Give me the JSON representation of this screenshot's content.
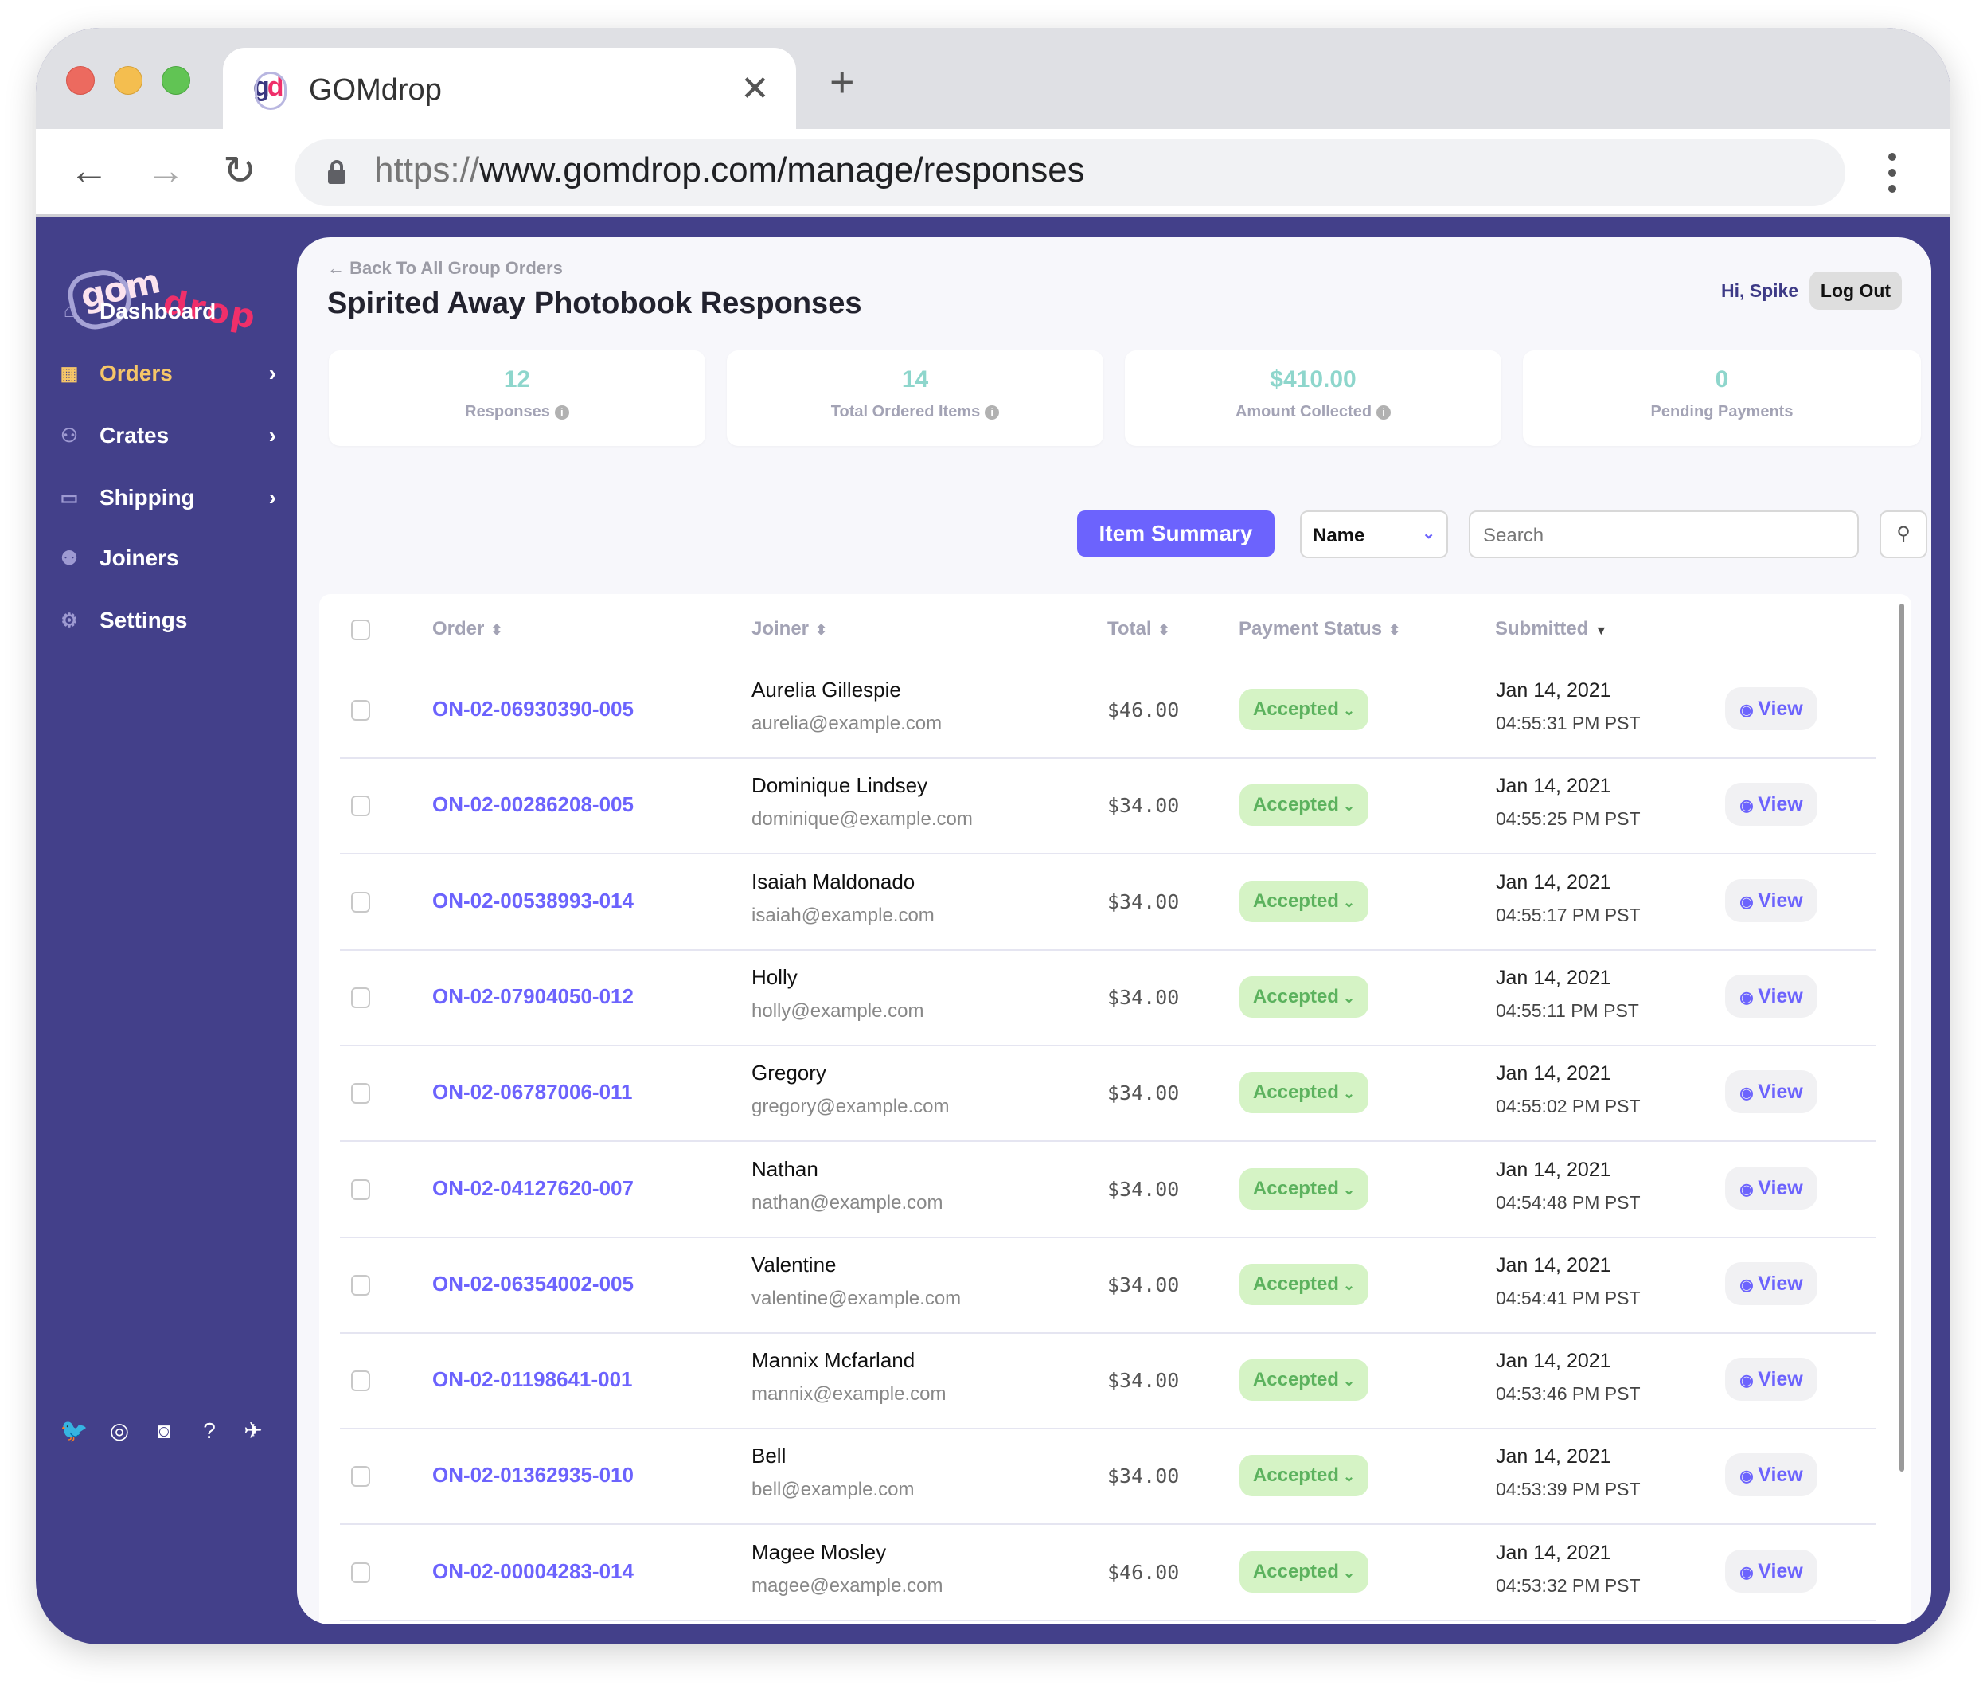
{
  "browser": {
    "tab_title": "GOMdrop",
    "tab_favicon": "gd",
    "url_protocol": "https://",
    "url_rest": "www.gomdrop.com/manage/responses",
    "close_tab": "✕",
    "new_tab": "+"
  },
  "sidebar": {
    "logo_part1": "gom",
    "logo_part2": "drop",
    "items": [
      {
        "label": "Dashboard",
        "icon": "home-icon",
        "glyph": "⌂",
        "has_chevron": false,
        "active": false
      },
      {
        "label": "Orders",
        "icon": "grid-icon",
        "glyph": "▦",
        "has_chevron": true,
        "active": true
      },
      {
        "label": "Crates",
        "icon": "people-carry-icon",
        "glyph": "⚇",
        "has_chevron": true,
        "active": false
      },
      {
        "label": "Shipping",
        "icon": "box-open-icon",
        "glyph": "▭",
        "has_chevron": true,
        "active": false
      },
      {
        "label": "Joiners",
        "icon": "users-icon",
        "glyph": "⚉",
        "has_chevron": false,
        "active": false
      },
      {
        "label": "Settings",
        "icon": "gear-icon",
        "glyph": "⚙",
        "has_chevron": false,
        "active": false
      }
    ],
    "chevron": "›",
    "social": [
      {
        "name": "twitter-icon",
        "glyph": "🐦"
      },
      {
        "name": "instagram-icon",
        "glyph": "◎"
      },
      {
        "name": "discord-icon",
        "glyph": "◙"
      },
      {
        "name": "help-icon",
        "glyph": "?"
      },
      {
        "name": "airplane-icon",
        "glyph": "✈"
      }
    ]
  },
  "header": {
    "back_link": "← Back To All Group Orders",
    "title": "Spirited Away Photobook Responses",
    "greeting": "Hi, Spike",
    "logout_label": "Log Out"
  },
  "stats": [
    {
      "value": "12",
      "label": "Responses",
      "info": true
    },
    {
      "value": "14",
      "label": "Total Ordered Items",
      "info": true
    },
    {
      "value": "$410.00",
      "label": "Amount Collected",
      "info": true
    },
    {
      "value": "0",
      "label": "Pending Payments",
      "info": false
    }
  ],
  "toolbar": {
    "item_summary_label": "Item Summary",
    "filter_selected": "Name",
    "search_placeholder": "Search"
  },
  "table": {
    "columns": [
      {
        "label": "Order",
        "sort": "both"
      },
      {
        "label": "Joiner",
        "sort": "both"
      },
      {
        "label": "Total",
        "sort": "both"
      },
      {
        "label": "Payment Status",
        "sort": "both"
      },
      {
        "label": "Submitted",
        "sort": "desc"
      }
    ],
    "view_label": "View",
    "rows": [
      {
        "order": "ON-02-06930390-005",
        "name": "Aurelia Gillespie",
        "email": "aurelia@example.com",
        "total": "$46.00",
        "status": "Accepted",
        "date": "Jan 14, 2021",
        "time": "04:55:31 PM PST"
      },
      {
        "order": "ON-02-00286208-005",
        "name": "Dominique Lindsey",
        "email": "dominique@example.com",
        "total": "$34.00",
        "status": "Accepted",
        "date": "Jan 14, 2021",
        "time": "04:55:25 PM PST"
      },
      {
        "order": "ON-02-00538993-014",
        "name": "Isaiah Maldonado",
        "email": "isaiah@example.com",
        "total": "$34.00",
        "status": "Accepted",
        "date": "Jan 14, 2021",
        "time": "04:55:17 PM PST"
      },
      {
        "order": "ON-02-07904050-012",
        "name": "Holly",
        "email": "holly@example.com",
        "total": "$34.00",
        "status": "Accepted",
        "date": "Jan 14, 2021",
        "time": "04:55:11 PM PST"
      },
      {
        "order": "ON-02-06787006-011",
        "name": "Gregory",
        "email": "gregory@example.com",
        "total": "$34.00",
        "status": "Accepted",
        "date": "Jan 14, 2021",
        "time": "04:55:02 PM PST"
      },
      {
        "order": "ON-02-04127620-007",
        "name": "Nathan",
        "email": "nathan@example.com",
        "total": "$34.00",
        "status": "Accepted",
        "date": "Jan 14, 2021",
        "time": "04:54:48 PM PST"
      },
      {
        "order": "ON-02-06354002-005",
        "name": "Valentine",
        "email": "valentine@example.com",
        "total": "$34.00",
        "status": "Accepted",
        "date": "Jan 14, 2021",
        "time": "04:54:41 PM PST"
      },
      {
        "order": "ON-02-01198641-001",
        "name": "Mannix Mcfarland",
        "email": "mannix@example.com",
        "total": "$34.00",
        "status": "Accepted",
        "date": "Jan 14, 2021",
        "time": "04:53:46 PM PST"
      },
      {
        "order": "ON-02-01362935-010",
        "name": "Bell",
        "email": "bell@example.com",
        "total": "$34.00",
        "status": "Accepted",
        "date": "Jan 14, 2021",
        "time": "04:53:39 PM PST"
      },
      {
        "order": "ON-02-00004283-014",
        "name": "Magee Mosley",
        "email": "magee@example.com",
        "total": "$46.00",
        "status": "Accepted",
        "date": "Jan 14, 2021",
        "time": "04:53:32 PM PST"
      }
    ]
  },
  "colors": {
    "brand_purple": "#43408a",
    "accent": "#6c63fd",
    "stat_teal": "#8ed6cc",
    "status_bg": "#d5f3c5",
    "status_text": "#5cb25e",
    "active_nav": "#f6c668"
  }
}
